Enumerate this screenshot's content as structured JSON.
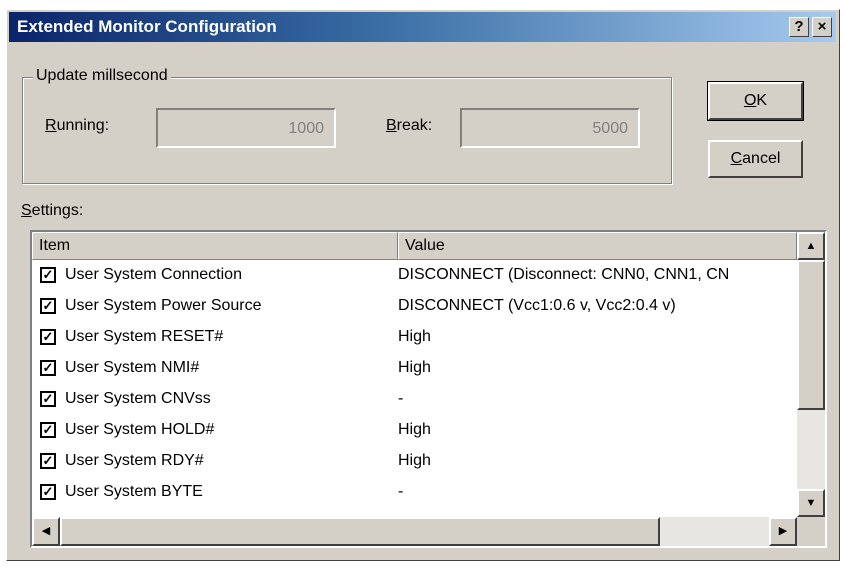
{
  "window": {
    "title": "Extended Monitor Configuration",
    "help_label": "?",
    "close_label": "×"
  },
  "update": {
    "group_label": "Update millsecond",
    "running_label_mnemonic": "R",
    "running_label_rest": "unning:",
    "running_value": "1000",
    "break_label_mnemonic": "B",
    "break_label_rest": "reak:",
    "break_value": "5000"
  },
  "buttons": {
    "ok_mnemonic": "O",
    "ok_rest": "K",
    "cancel_mnemonic": "C",
    "cancel_rest": "ancel"
  },
  "settings": {
    "label_mnemonic": "S",
    "label_rest": "ettings:",
    "columns": [
      "Item",
      "Value"
    ],
    "rows": [
      {
        "checked": true,
        "item": "User System Connection",
        "value": "DISCONNECT (Disconnect: CNN0, CNN1, CN"
      },
      {
        "checked": true,
        "item": "User System Power Source",
        "value": "DISCONNECT (Vcc1:0.6 v, Vcc2:0.4 v)"
      },
      {
        "checked": true,
        "item": "User System RESET#",
        "value": "High"
      },
      {
        "checked": true,
        "item": "User System NMI#",
        "value": "High"
      },
      {
        "checked": true,
        "item": "User System CNVss",
        "value": "-"
      },
      {
        "checked": true,
        "item": "User System HOLD#",
        "value": "High"
      },
      {
        "checked": true,
        "item": "User System RDY#",
        "value": "High"
      },
      {
        "checked": true,
        "item": "User System BYTE",
        "value": "-"
      }
    ]
  },
  "icons": {
    "check": "✓",
    "up": "▲",
    "down": "▼",
    "left": "◀",
    "right": "▶"
  }
}
